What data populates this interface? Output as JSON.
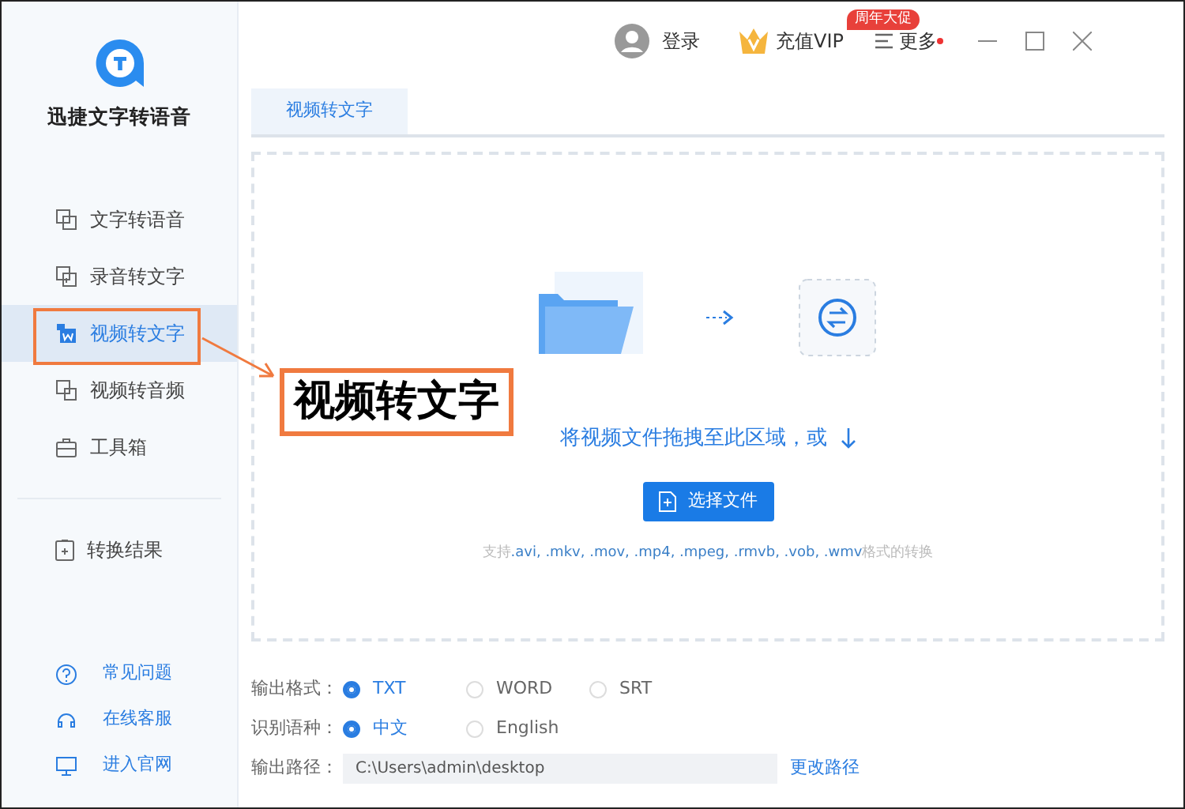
{
  "app": {
    "name": "迅捷文字转语音"
  },
  "sidebar": {
    "items": [
      {
        "label": "文字转语音",
        "selected": false
      },
      {
        "label": "录音转文字",
        "selected": false
      },
      {
        "label": "视频转文字",
        "selected": true
      },
      {
        "label": "视频转音频",
        "selected": false
      },
      {
        "label": "工具箱",
        "selected": false
      }
    ],
    "results": {
      "label": "转换结果"
    },
    "links": [
      {
        "label": "常见问题"
      },
      {
        "label": "在线客服"
      },
      {
        "label": "进入官网"
      }
    ]
  },
  "header": {
    "login": "登录",
    "vip": "充值VIP",
    "vip_badge": "周年大促",
    "more": "更多",
    "notification": true
  },
  "tabs": [
    {
      "label": "视频转文字",
      "selected": true
    }
  ],
  "drop_zone": {
    "prompt": "将视频文件拖拽至此区域，或",
    "button": "选择文件",
    "formats_prefix": "支持",
    "formats": ".avi, .mkv, .mov, .mp4, .mpeg, .rmvb, .vob, .wmv",
    "formats_suffix": "格式的转换"
  },
  "options": [
    {
      "label": "输出格式：",
      "choices": [
        {
          "label": "TXT",
          "selected": true
        },
        {
          "label": "WORD",
          "selected": false
        },
        {
          "label": "SRT",
          "selected": false
        }
      ]
    },
    {
      "label": "识别语种：",
      "choices": [
        {
          "label": "中文",
          "selected": true
        },
        {
          "label": "English",
          "selected": false
        }
      ]
    }
  ],
  "output_path": {
    "label": "输出路径：",
    "value": "C:\\Users\\admin\\desktop",
    "change": "更改路径"
  },
  "annotation": {
    "label": "视频转文字"
  }
}
